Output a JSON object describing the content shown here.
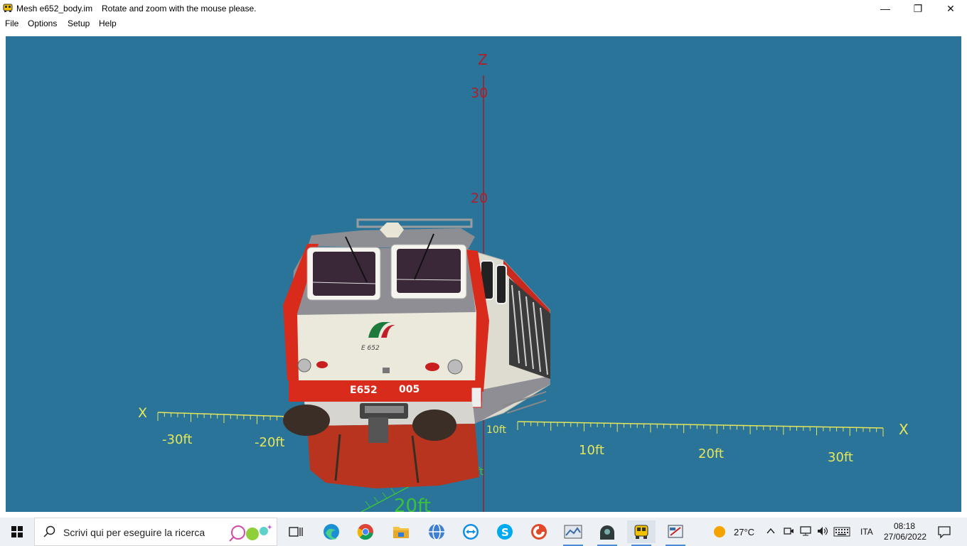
{
  "window": {
    "title": "Mesh e652_body.im",
    "hint": "Rotate and zoom with the mouse please.",
    "minimize_glyph": "—",
    "maximize_glyph": "❐",
    "close_glyph": "✕"
  },
  "menu": {
    "items": [
      {
        "label": "File"
      },
      {
        "label": "Options"
      },
      {
        "label": "Setup"
      },
      {
        "label": "Help"
      }
    ]
  },
  "viewport": {
    "background": "#2a7499",
    "z_axis_label": "Z",
    "z_ticks": [
      "30",
      "20"
    ],
    "x_axis_label_left": "X",
    "x_axis_label_right": "X",
    "x_ticks": [
      "-30ft",
      "-20ft",
      "10ft",
      "10ft",
      "20ft",
      "30ft"
    ],
    "lower_labels": [
      "20ft",
      "10ft"
    ],
    "loco_number_left": "E652",
    "loco_number_right": "005",
    "loco_badge": "E 652"
  },
  "taskbar": {
    "search_placeholder": "Scrivi qui per eseguire la ricerca",
    "icons": [
      {
        "name": "task-view-icon"
      },
      {
        "name": "edge-icon"
      },
      {
        "name": "chrome-icon"
      },
      {
        "name": "file-explorer-icon"
      },
      {
        "name": "app-globe-icon"
      },
      {
        "name": "teamviewer-icon"
      },
      {
        "name": "skype-icon"
      },
      {
        "name": "ccleaner-icon"
      },
      {
        "name": "photo-app-icon"
      },
      {
        "name": "dark-app-icon"
      },
      {
        "name": "train-app-icon"
      },
      {
        "name": "mesh-viewer-icon"
      }
    ],
    "weather_temp": "27°C",
    "language": "ITA",
    "time": "08:18",
    "date": "27/06/2022"
  }
}
